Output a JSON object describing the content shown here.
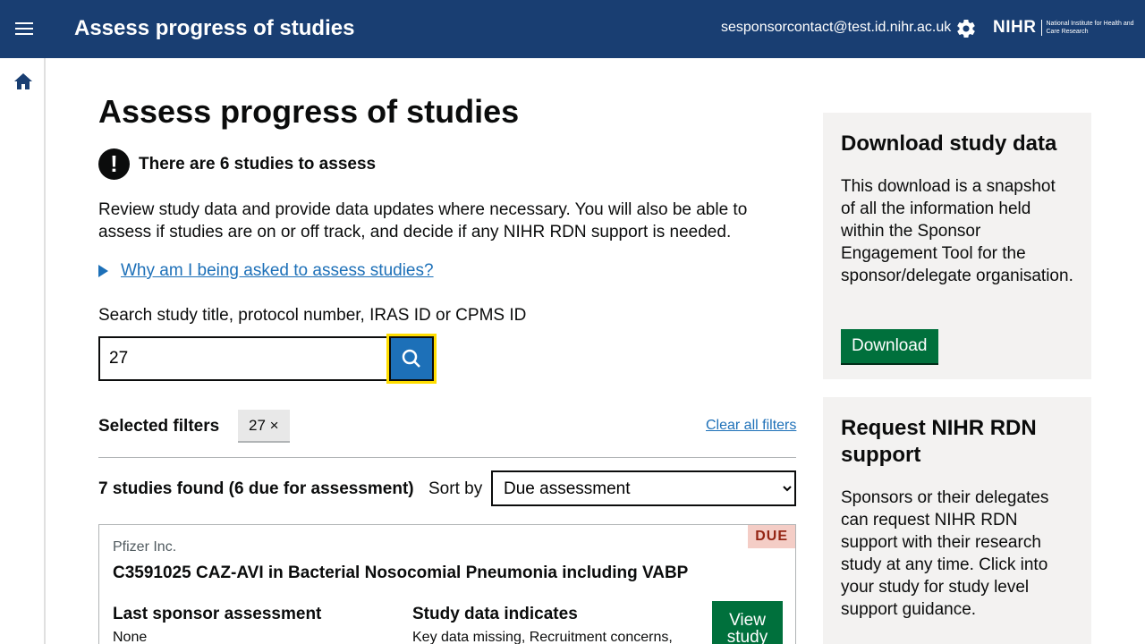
{
  "header": {
    "title": "Assess progress of studies",
    "user_email": "sesponsorcontact@test.id.nihr.ac.uk",
    "logo_main": "NIHR",
    "logo_sub": "National Institute for Health and Care Research"
  },
  "main": {
    "heading": "Assess progress of studies",
    "warning_text": "There are 6 studies to assess",
    "intro": "Review study data and provide data updates where necessary. You will also be able to assess if studies are on or off track, and decide if any NIHR RDN support is needed.",
    "details_link": "Why am I being asked to assess studies?",
    "search_label": "Search study title, protocol number, IRAS ID or CPMS ID",
    "search_value": "27",
    "filters_label": "Selected filters",
    "filter_tag": "27 ×",
    "clear_filters": "Clear all filters",
    "results_count": "7 studies found (6 due for assessment)",
    "sort_label": "Sort by",
    "sort_value": "Due assessment"
  },
  "study_card": {
    "badge": "DUE",
    "sponsor": "Pfizer Inc.",
    "title": "C3591025 CAZ-AVI in Bacterial Nosocomial Pneumonia including VABP",
    "last_assessment_label": "Last sponsor assessment",
    "last_assessment_value": "None",
    "data_indicates_label": "Study data indicates",
    "data_indicates_value": "Key data missing, Recruitment concerns,",
    "view_button": "View study"
  },
  "sidebar_panels": {
    "download_heading": "Download study data",
    "download_text": "This download is a snapshot of all the information held within the Sponsor Engagement Tool for the sponsor/delegate organisation.",
    "download_button": "Download",
    "support_heading": "Request NIHR RDN support",
    "support_text": "Sponsors or their delegates can request NIHR RDN support with their research study at any time. Click into your study for study level support guidance."
  },
  "colors": {
    "header_bg": "#193e72",
    "link": "#1d70b8",
    "button_green": "#00703c",
    "focus_yellow": "#ffdd00",
    "panel_bg": "#f3f2f1"
  }
}
